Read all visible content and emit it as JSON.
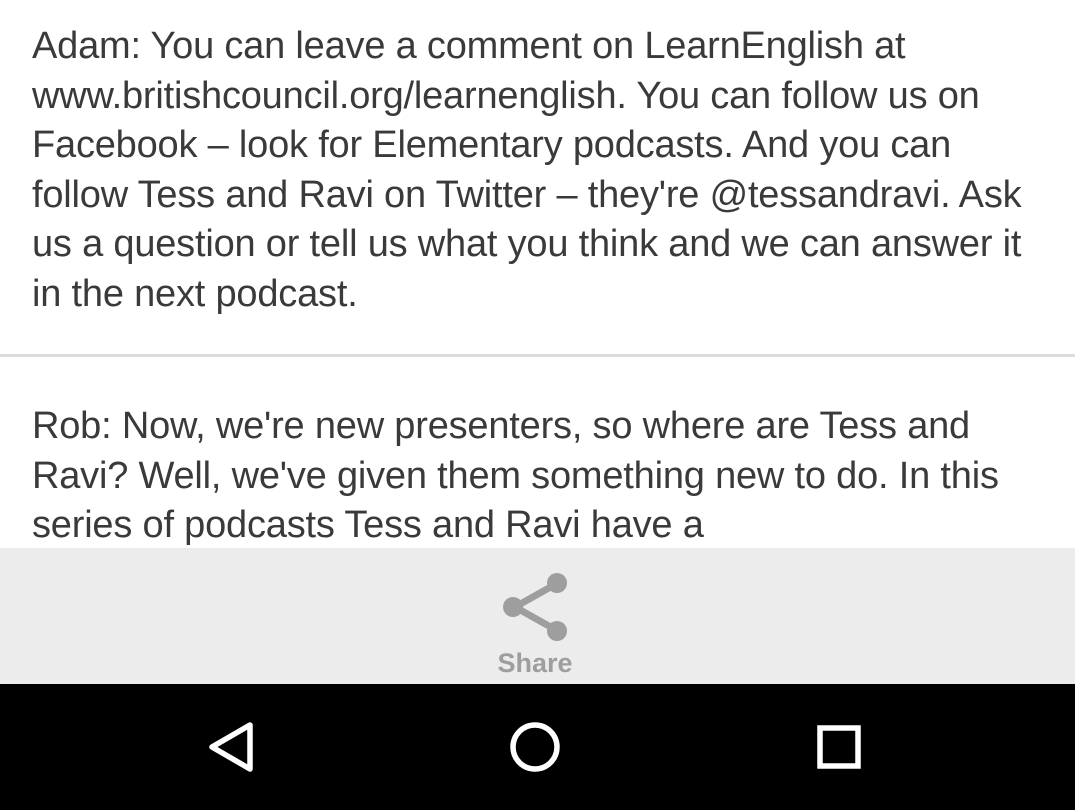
{
  "article": {
    "paragraphs": [
      "Adam: You can leave a comment on LearnEnglish at www.britishcouncil.org/learnenglish. You can follow us on Facebook – look for Elementary podcasts. And you can follow Tess and Ravi on Twitter – they're @tessandravi. Ask us a question or tell us what you think and we can answer it in the next podcast.",
      "Rob: Now, we're new presenters, so where are Tess and Ravi? Well, we've given them something new to do. In this series of podcasts Tess and Ravi have a"
    ]
  },
  "share_bar": {
    "label": "Share",
    "icon": "share-icon",
    "background": "#ececec",
    "icon_color": "#9e9e9e"
  },
  "nav_bar": {
    "background": "#000000",
    "icon_color": "#ffffff",
    "buttons": [
      {
        "name": "back",
        "icon": "back-triangle-icon"
      },
      {
        "name": "home",
        "icon": "home-circle-icon"
      },
      {
        "name": "recents",
        "icon": "recents-square-icon"
      }
    ]
  }
}
